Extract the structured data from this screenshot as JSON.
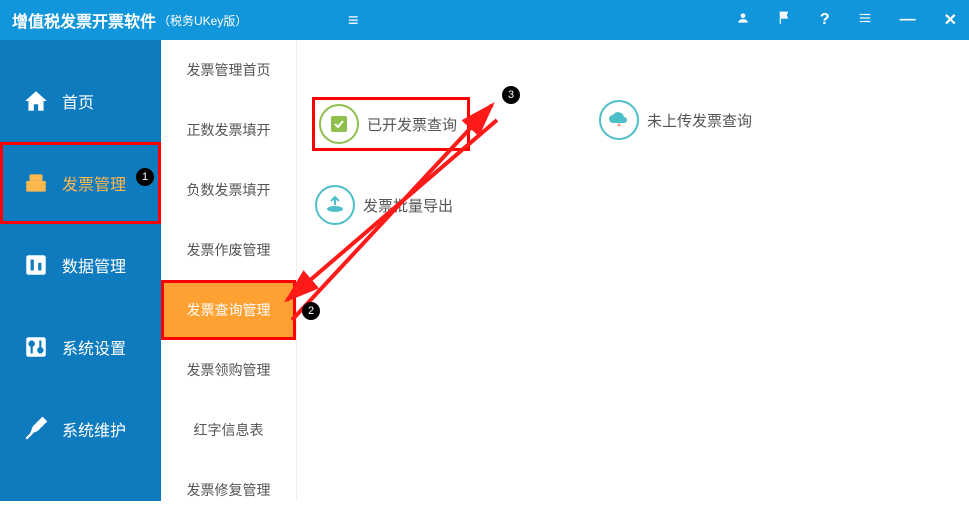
{
  "header": {
    "title": "增值税发票开票软件",
    "subtitle": "（税务UKey版）"
  },
  "sidebar": {
    "items": [
      {
        "label": "首页",
        "icon": "home"
      },
      {
        "label": "发票管理",
        "icon": "invoice",
        "highlighted": true
      },
      {
        "label": "数据管理",
        "icon": "data"
      },
      {
        "label": "系统设置",
        "icon": "settings"
      },
      {
        "label": "系统维护",
        "icon": "tools"
      }
    ]
  },
  "submenu": {
    "items": [
      {
        "label": "发票管理首页"
      },
      {
        "label": "正数发票填开"
      },
      {
        "label": "负数发票填开"
      },
      {
        "label": "发票作废管理"
      },
      {
        "label": "发票查询管理",
        "active": true
      },
      {
        "label": "发票领购管理"
      },
      {
        "label": "红字信息表"
      },
      {
        "label": "发票修复管理"
      }
    ]
  },
  "content": {
    "functions": [
      {
        "label": "已开发票查询",
        "icon": "check",
        "color": "#8fbf4d",
        "highlighted": true
      },
      {
        "label": "未上传发票查询",
        "icon": "cloud",
        "color": "#4dbfc9"
      },
      {
        "label": "发票批量导出",
        "icon": "export",
        "color": "#4dbfc9"
      }
    ]
  },
  "annotations": {
    "b1": "1",
    "b2": "2",
    "b3": "3"
  }
}
